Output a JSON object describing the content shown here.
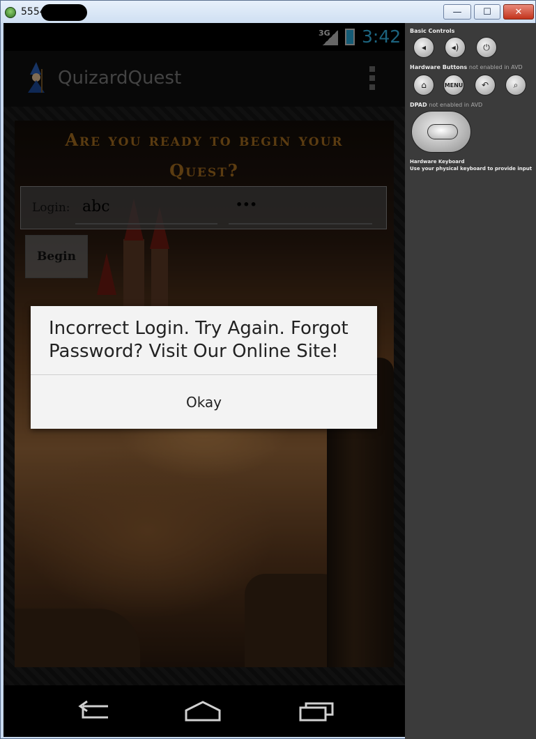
{
  "window": {
    "title": "5554",
    "controls": {
      "minimize": "—",
      "maximize": "☐",
      "close": "✕"
    }
  },
  "status_bar": {
    "network": "3G",
    "time": "3:42"
  },
  "app_bar": {
    "title": "QuizardQuest",
    "overflow_icon": "overflow-menu-icon"
  },
  "main": {
    "heading": "Are you ready to begin your Quest?",
    "login_label": "Login:",
    "username_value": "abc",
    "password_value": "•••",
    "begin_label": "Begin"
  },
  "dialog": {
    "message": "Incorrect Login. Try Again. Forgot Password? Visit Our Online Site!",
    "button": "Okay"
  },
  "nav": {
    "back": "back-icon",
    "home": "home-icon",
    "recents": "recent-apps-icon"
  },
  "side_panel": {
    "basic_controls": "Basic Controls",
    "hardware_buttons": "Hardware Buttons",
    "hardware_buttons_note": "not enabled in AVD",
    "menu_label": "MENU",
    "dpad": "DPAD",
    "dpad_note": "not enabled in AVD",
    "keyboard_title": "Hardware Keyboard",
    "keyboard_note": "Use your physical keyboard to provide input"
  },
  "colors": {
    "clock": "#33b5e5",
    "heading_gold": "#a76d1f",
    "dialog_bg": "#f3f3f3"
  }
}
